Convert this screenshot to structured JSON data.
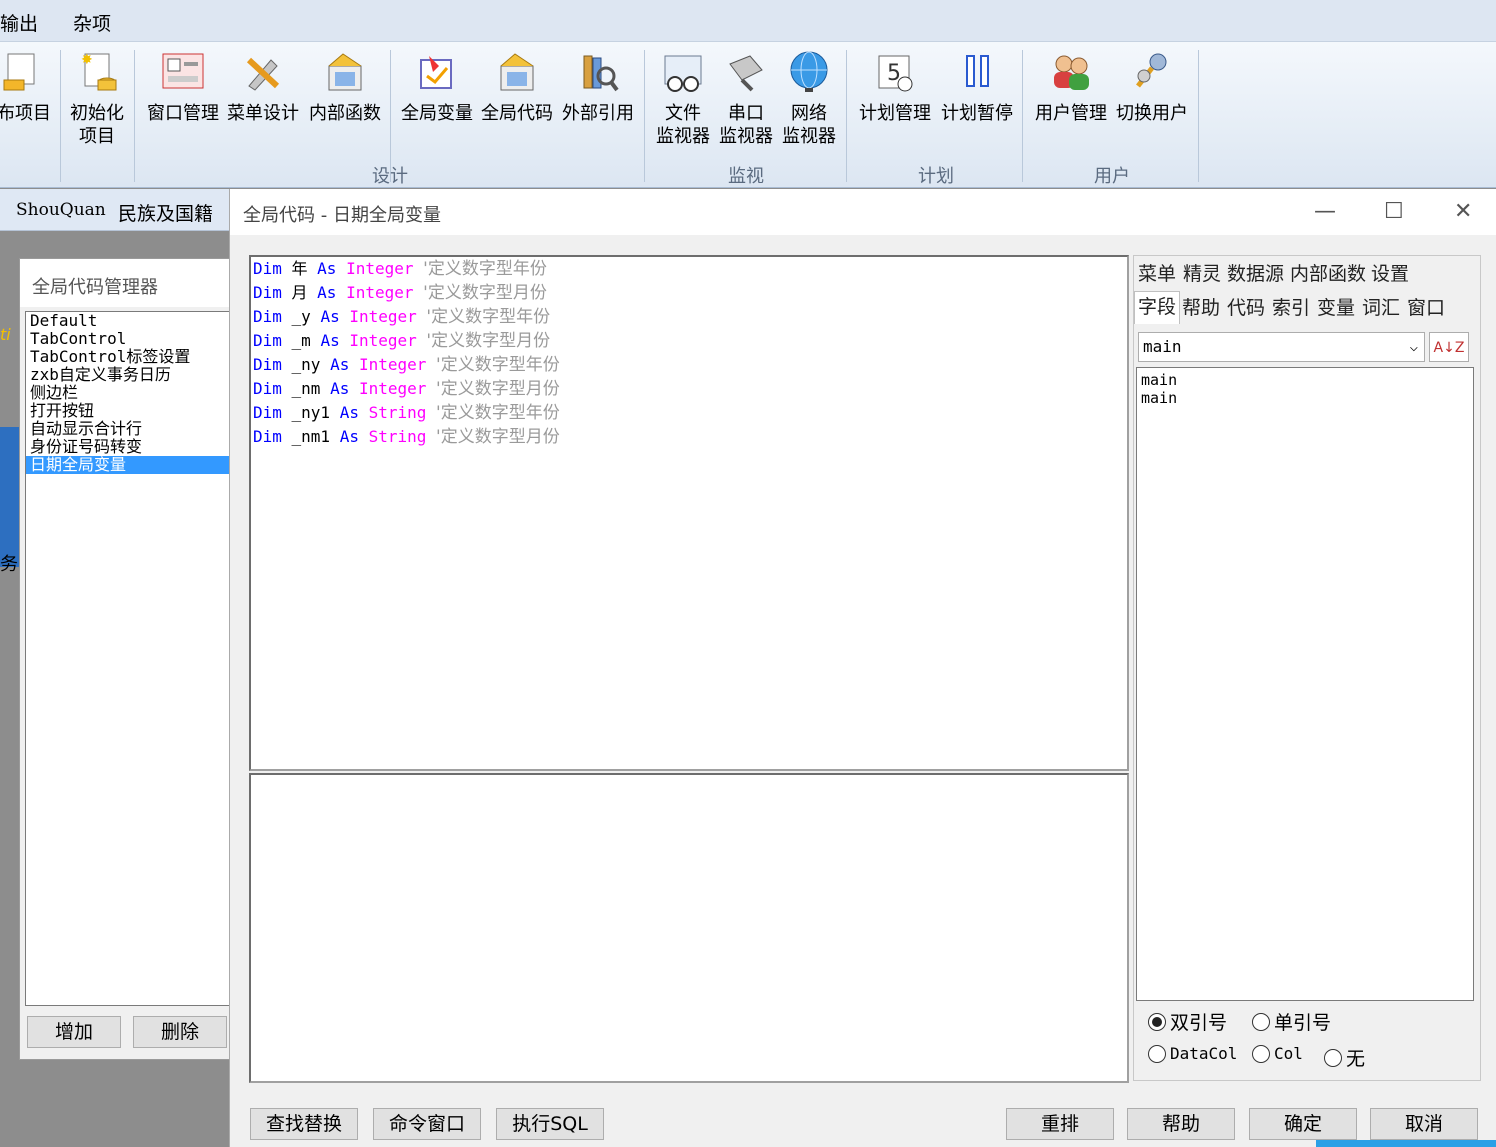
{
  "menubar": {
    "items": [
      "输出",
      "杂项"
    ]
  },
  "ribbon": {
    "buttons": [
      {
        "label": "布项目",
        "icon": "project-icon"
      },
      {
        "label": "初始化\n项目",
        "icon": "init-project-icon"
      },
      {
        "label": "窗口管理",
        "icon": "window-manage-icon"
      },
      {
        "label": "菜单设计",
        "icon": "menu-design-icon"
      },
      {
        "label": "内部函数",
        "icon": "internal-function-icon"
      },
      {
        "label": "全局变量",
        "icon": "global-variable-icon"
      },
      {
        "label": "全局代码",
        "icon": "global-code-icon"
      },
      {
        "label": "外部引用",
        "icon": "external-reference-icon"
      },
      {
        "label": "文件\n监视器",
        "icon": "file-monitor-icon"
      },
      {
        "label": "串口\n监视器",
        "icon": "serial-monitor-icon"
      },
      {
        "label": "网络\n监视器",
        "icon": "network-monitor-icon"
      },
      {
        "label": "计划管理",
        "icon": "schedule-icon"
      },
      {
        "label": "计划暂停",
        "icon": "pause-icon"
      },
      {
        "label": "用户管理",
        "icon": "user-manage-icon"
      },
      {
        "label": "切换用户",
        "icon": "switch-user-icon"
      }
    ],
    "groups": [
      "设计",
      "监视",
      "计划",
      "用户"
    ]
  },
  "tabstrip": {
    "tabs": [
      "ShouQuan",
      "民族及国籍"
    ]
  },
  "background_fragments": [
    "ti",
    "务"
  ],
  "manager": {
    "title": "全局代码管理器",
    "items": [
      "Default",
      "TabControl",
      "TabControl标签设置",
      "zxb自定义事务日历",
      "侧边栏",
      "打开按钮",
      "自动显示合计行",
      "身份证号码转变",
      "日期全局变量"
    ],
    "selected_index": 8,
    "add_label": "增加",
    "delete_label": "删除"
  },
  "dialog": {
    "title": "全局代码 - 日期全局变量",
    "controls": {
      "minimize": "—",
      "maximize": "☐",
      "close": "✕"
    },
    "code_lines": [
      {
        "kw1": "Dim",
        "name": "年",
        "kw2": "As",
        "type": "Integer",
        "comment": "'定义数字型年份"
      },
      {
        "kw1": "Dim",
        "name": "月",
        "kw2": "As",
        "type": "Integer",
        "comment": "'定义数字型月份"
      },
      {
        "kw1": "Dim",
        "name": "_y",
        "kw2": "As",
        "type": "Integer",
        "comment": "'定义数字型年份"
      },
      {
        "kw1": "Dim",
        "name": "_m",
        "kw2": "As",
        "type": "Integer",
        "comment": "'定义数字型月份"
      },
      {
        "kw1": "Dim",
        "name": "_ny",
        "kw2": "As",
        "type": "Integer",
        "comment": "'定义数字型年份"
      },
      {
        "kw1": "Dim",
        "name": "_nm",
        "kw2": "As",
        "type": "Integer",
        "comment": "'定义数字型月份"
      },
      {
        "kw1": "Dim",
        "name": "_ny1",
        "kw2": "As",
        "type": "String",
        "comment": "'定义数字型年份"
      },
      {
        "kw1": "Dim",
        "name": "_nm1",
        "kw2": "As",
        "type": "String",
        "comment": "'定义数字型月份"
      }
    ],
    "right_panel": {
      "tabs_row1": [
        "菜单",
        "精灵",
        "数据源",
        "内部函数",
        "设置"
      ],
      "tabs_row2": [
        "字段",
        "帮助",
        "代码",
        "索引",
        "变量",
        "词汇",
        "窗口"
      ],
      "active_tab": "字段",
      "field_select": "main",
      "sort_label": "A↓Z",
      "field_list": [
        "main",
        "main"
      ],
      "radios_row1": [
        {
          "label": "双引号",
          "checked": true
        },
        {
          "label": "单引号",
          "checked": false
        }
      ],
      "radios_row2": [
        {
          "label": "DataCol",
          "checked": false
        },
        {
          "label": "Col",
          "checked": false
        },
        {
          "label": "无",
          "checked": false
        }
      ]
    },
    "bottom_buttons": {
      "find_replace": "查找替换",
      "command_window": "命令窗口",
      "execute_sql": "执行SQL",
      "reorder": "重排",
      "help": "帮助",
      "ok": "确定",
      "cancel": "取消"
    }
  },
  "colors": {
    "keyword": "#0000ff",
    "type": "#ff00ff",
    "comment": "#9a9a9a",
    "selection": "#3399ff"
  }
}
